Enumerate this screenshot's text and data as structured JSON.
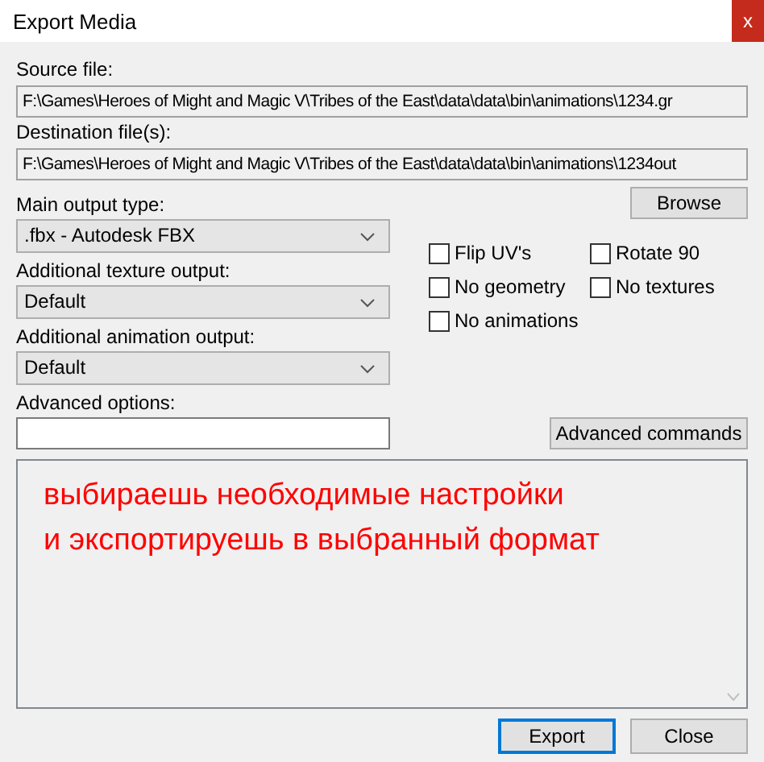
{
  "window": {
    "title": "Export Media",
    "close": "x"
  },
  "source": {
    "label": "Source file:",
    "value": "F:\\Games\\Heroes of Might and Magic V\\Tribes of the East\\data\\data\\bin\\animations\\1234.gr"
  },
  "destination": {
    "label": "Destination file(s):",
    "value": "F:\\Games\\Heroes of Might and Magic V\\Tribes of the East\\data\\data\\bin\\animations\\1234out"
  },
  "browse_button": "Browse",
  "dropdowns": [
    {
      "label": "Main output type:",
      "value": ".fbx - Autodesk FBX"
    },
    {
      "label": "Additional texture output:",
      "value": "Default"
    },
    {
      "label": "Additional animation output:",
      "value": "Default"
    }
  ],
  "checkboxes": [
    {
      "label": "Flip UV's",
      "checked": false
    },
    {
      "label": "Rotate 90",
      "checked": false
    },
    {
      "label": "No geometry",
      "checked": false
    },
    {
      "label": "No textures",
      "checked": false
    },
    {
      "label": "No animations",
      "checked": false
    }
  ],
  "advanced_options": {
    "label": "Advanced options:"
  },
  "advanced_commands_button": "Advanced commands",
  "log": {
    "lines": [
      "выбираешь необходимые настройки",
      "и экспортируешь в выбранный формат"
    ]
  },
  "buttons": [
    {
      "label": "Export",
      "default": true
    },
    {
      "label": "Close",
      "default": false
    }
  ]
}
